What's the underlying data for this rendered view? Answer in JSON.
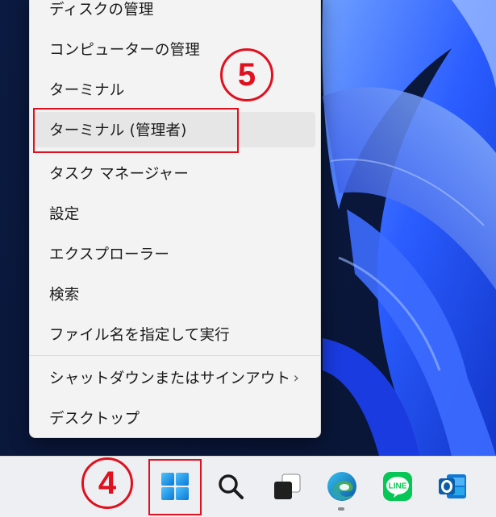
{
  "menu": {
    "items": [
      {
        "label": "ディスクの管理"
      },
      {
        "label": "コンピューターの管理"
      },
      {
        "label": "ターミナル"
      },
      {
        "label": "ターミナル (管理者)"
      },
      {
        "label": "タスク マネージャー"
      },
      {
        "label": "設定"
      },
      {
        "label": "エクスプローラー"
      },
      {
        "label": "検索"
      },
      {
        "label": "ファイル名を指定して実行"
      },
      {
        "label": "シャットダウンまたはサインアウト"
      },
      {
        "label": "デスクトップ"
      }
    ],
    "submenu_chevron": "›",
    "hover_color": "#e6e6e6"
  },
  "annotations": {
    "step5": "5",
    "step4": "4",
    "color": "#e0101e"
  },
  "taskbar": {
    "icons": [
      {
        "name": "start-icon"
      },
      {
        "name": "search-icon"
      },
      {
        "name": "task-view-icon"
      },
      {
        "name": "edge-icon"
      },
      {
        "name": "line-icon",
        "label": "LINE"
      },
      {
        "name": "outlook-icon"
      }
    ]
  }
}
